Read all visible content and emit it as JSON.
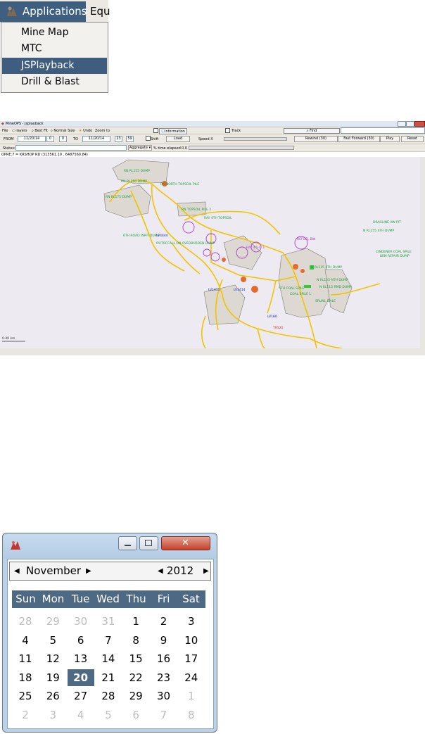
{
  "menu": {
    "app_label": "Applications",
    "next_label_partial": "Equ",
    "items": [
      {
        "label": "Mine Map",
        "selected": false
      },
      {
        "label": "MTC",
        "selected": false
      },
      {
        "label": "JSPlayback",
        "selected": true
      },
      {
        "label": "Drill & Blast",
        "selected": false
      }
    ],
    "highlight_color": "#3e5d7f"
  },
  "playback": {
    "window_title": "MineOPS - Jsplayback",
    "toolbar": {
      "file": "File",
      "layers": "layers",
      "best_fit": "Best Fit",
      "normal_size": "Normal Size",
      "undo": "Undo",
      "zoom_to": "Zoom to",
      "information": "Information",
      "track": "Track",
      "find": "Find"
    },
    "controls": {
      "from_label": "FROM",
      "from_date": "11/20/14",
      "from_h": "0",
      "from_m": "0",
      "to_label": "TO",
      "to_date": "11/20/14",
      "to_h": "23",
      "to_m": "59",
      "shift": "Shift",
      "load": "Load",
      "speed": "Speed X",
      "rewind": "Rewind (30)",
      "fast_forward": "Fast Forward (30)",
      "play": "Play",
      "reset": "Reset",
      "status_label": "Status:",
      "aggregate": "Aggregate",
      "time_elapsed": "% time elapsed",
      "time_value": "0.0"
    },
    "coord_bar": "OPRE:7 = KRSHOP RD (313561.10 , 6487560.84)",
    "scale": "0.40 km",
    "map_labels": [
      "RN RL155 DUMP",
      "RN RL150 DUMP",
      "RN NORTH TOPSOIL PILE",
      "RN RL175 DUMP",
      "RN TOPSOIL PILE 2",
      "RAY 4TH TOPSOIL",
      "6TH ROAD INPIT DUMP",
      "LV4444",
      "OUTOFCALL ON OVERBURDEN DUMP",
      "RAY 4TH - 1",
      "REFUEL BIN",
      "DRAGLINE AW PIT",
      "N RL155 4TH DUMP",
      "CINDENER COAL SPILE",
      "80M REPAIR DUMP",
      "LV1411",
      "LV1414",
      "N RL115 4TH DUMP",
      "N RL155 NTH DUMP",
      "N RL115 RMD DUMP",
      "5TH COAL SPILE",
      "COAL SPILE 1",
      "SRUNL SPILE",
      "LV160",
      "TRS20"
    ],
    "map_colors": {
      "road": "#f0c400",
      "dump": "#ddd9d2",
      "label_green": "#18a23a",
      "label_red": "#d03a28",
      "label_blue": "#1020b0",
      "circle": "#a93cd0"
    }
  },
  "calendar": {
    "month": "November",
    "year": "2012",
    "dow": [
      "Sun",
      "Mon",
      "Tue",
      "Wed",
      "Thu",
      "Fri",
      "Sat"
    ],
    "weeks": [
      [
        "28",
        "29",
        "30",
        "31",
        "1",
        "2",
        "3"
      ],
      [
        "4",
        "5",
        "6",
        "7",
        "8",
        "9",
        "10"
      ],
      [
        "11",
        "12",
        "13",
        "14",
        "15",
        "16",
        "17"
      ],
      [
        "18",
        "19",
        "20",
        "21",
        "22",
        "23",
        "24"
      ],
      [
        "25",
        "26",
        "27",
        "28",
        "29",
        "30",
        "1"
      ],
      [
        "2",
        "3",
        "4",
        "5",
        "6",
        "7",
        "8"
      ]
    ],
    "selected_day": "20",
    "header_color": "#4d6983"
  }
}
